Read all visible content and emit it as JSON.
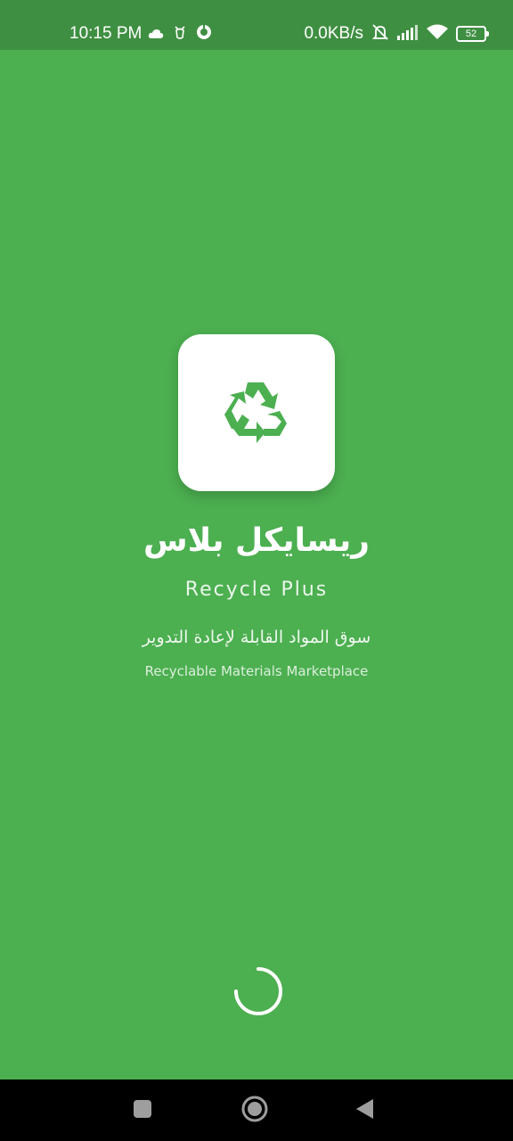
{
  "status_bar": {
    "time": "10:15 PM",
    "left_icons": [
      "cloud-icon",
      "bug-icon",
      "sync-icon"
    ],
    "net_speed": "0.0KB/s",
    "right_icons": [
      "bell-muted-icon",
      "signal-icon",
      "wifi-icon"
    ],
    "battery_level": "52"
  },
  "splash": {
    "logo_icon": "recycle-icon",
    "title_ar": "ريسايكل بلاس",
    "title_en": "Recycle Plus",
    "subtitle_ar": "سوق المواد القابلة لإعادة التدوير",
    "subtitle_en": "Recyclable Materials Marketplace",
    "loading": "loading-spinner"
  },
  "nav_bar": {
    "buttons": [
      "recents-button",
      "home-button",
      "back-button"
    ]
  },
  "colors": {
    "background": "#4caf50",
    "status_bar": "#3f8f42",
    "accent": "#4caf50",
    "card": "#ffffff"
  }
}
